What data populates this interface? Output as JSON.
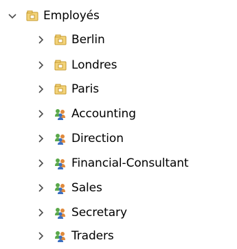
{
  "tree": {
    "root": {
      "label": "Employés",
      "icon": "folder-icon",
      "expanded": true
    },
    "children": [
      {
        "label": "Berlin",
        "icon": "folder-icon",
        "expanded": false
      },
      {
        "label": "Londres",
        "icon": "folder-icon",
        "expanded": false
      },
      {
        "label": "Paris",
        "icon": "folder-icon",
        "expanded": false
      },
      {
        "label": "Accounting",
        "icon": "user-group-icon",
        "expanded": false
      },
      {
        "label": "Direction",
        "icon": "user-group-icon",
        "expanded": false
      },
      {
        "label": "Financial-Consultant",
        "icon": "user-group-icon",
        "expanded": false
      },
      {
        "label": "Sales",
        "icon": "user-group-icon",
        "expanded": false
      },
      {
        "label": "Secretary",
        "icon": "user-group-icon",
        "expanded": false
      },
      {
        "label": "Traders",
        "icon": "user-group-icon",
        "expanded": false
      }
    ]
  },
  "colors": {
    "folder_fill": "#f3d37a",
    "folder_stroke": "#c59a2c",
    "chevron": "#4a4a4a",
    "group_green": "#5aa84a",
    "group_orange": "#e08a3c",
    "group_blue": "#3b6fc0"
  }
}
